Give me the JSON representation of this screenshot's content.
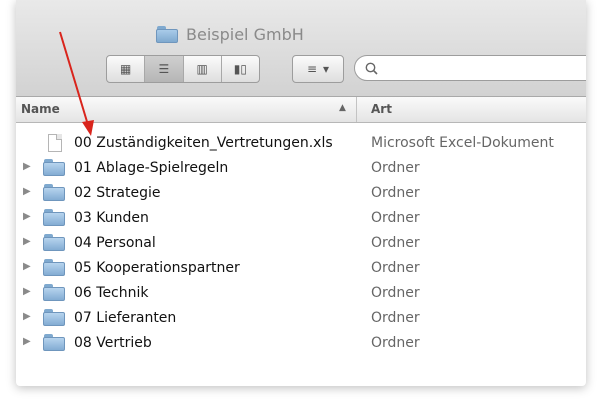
{
  "window": {
    "title": "Beispiel GmbH"
  },
  "toolbar": {
    "view_buttons": [
      {
        "icon": "icon-view-icon",
        "glyph": "▦",
        "active": false
      },
      {
        "icon": "list-view-icon",
        "glyph": "☰",
        "active": true
      },
      {
        "icon": "column-view-icon",
        "glyph": "▥",
        "active": false
      },
      {
        "icon": "coverflow-view-icon",
        "glyph": "▮▯",
        "active": false
      }
    ],
    "arrange_glyph": "≡",
    "arrange_caret": "▾",
    "search": {
      "value": "",
      "placeholder": "",
      "icon": "magnifier-icon"
    }
  },
  "columns": {
    "name": "Name",
    "sort_glyph": "▲",
    "kind": "Art"
  },
  "files": [
    {
      "name": "00 Zuständigkeiten_Vertretungen.xls",
      "kind": "Microsoft Excel-Dokument",
      "type": "file"
    },
    {
      "name": "01 Ablage-Spielregeln",
      "kind": "Ordner",
      "type": "folder"
    },
    {
      "name": "02 Strategie",
      "kind": "Ordner",
      "type": "folder"
    },
    {
      "name": "03 Kunden",
      "kind": "Ordner",
      "type": "folder"
    },
    {
      "name": "04 Personal",
      "kind": "Ordner",
      "type": "folder"
    },
    {
      "name": "05 Kooperationspartner",
      "kind": "Ordner",
      "type": "folder"
    },
    {
      "name": "06 Technik",
      "kind": "Ordner",
      "type": "folder"
    },
    {
      "name": "07 Lieferanten",
      "kind": "Ordner",
      "type": "folder"
    },
    {
      "name": "08 Vertrieb",
      "kind": "Ordner",
      "type": "folder"
    }
  ],
  "disclosure_glyph": "▶",
  "colors": {
    "annotation_arrow": "#d9241c",
    "folder": "#83acd3"
  }
}
